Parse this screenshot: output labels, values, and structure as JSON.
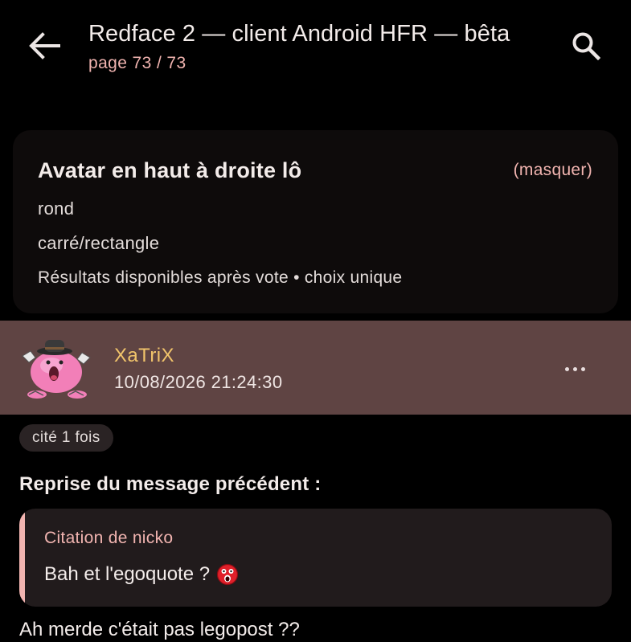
{
  "appbar": {
    "title": "Redface 2 — client Android HFR — bêta",
    "subtitle": "page 73 / 73",
    "back_icon": "arrow-left-icon",
    "search_icon": "search-icon"
  },
  "poll": {
    "question": "Avatar en haut à droite lô",
    "hide_label": "(masquer)",
    "options": [
      "rond",
      "carré/rectangle"
    ],
    "footer": "Résultats disponibles après vote • choix unique"
  },
  "post": {
    "author": "XaTriX",
    "date": "10/08/2026 21:24:30",
    "menu_icon": "more-horizontal-icon",
    "cited_label": "cité 1 fois",
    "reprise": "Reprise du message précédent :",
    "quote": {
      "author": "Citation de nicko",
      "text": "Bah et l'egoquote ?",
      "smiley": "shocked-smiley-icon"
    },
    "body": "Ah merde c'était pas legopost ??"
  },
  "colors": {
    "background": "#000000",
    "accent": "#f1b4b0",
    "author": "#f1c46b",
    "post_header": "#5f4443",
    "card": "#0e0b0b",
    "quote_bg": "#211b1c"
  }
}
